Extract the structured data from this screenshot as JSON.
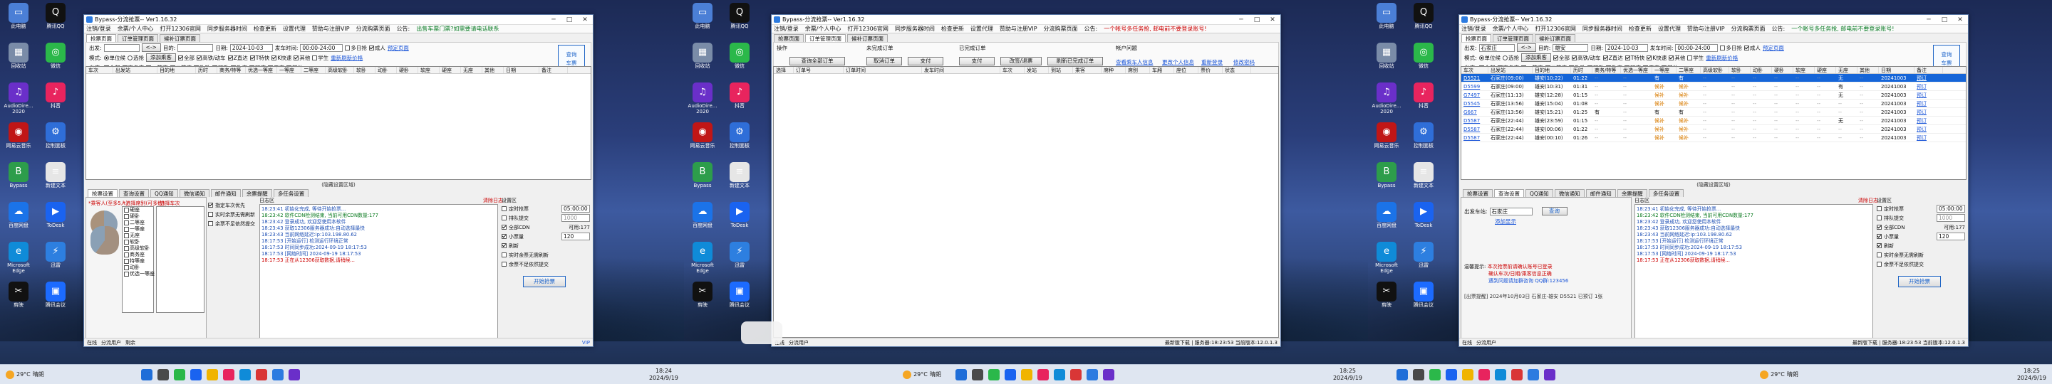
{
  "desktop_icons": [
    {
      "label": "此电脑",
      "color": "#4b7fd6",
      "glyph": "▭"
    },
    {
      "label": "腾讯QQ",
      "color": "#111111",
      "glyph": "Q"
    },
    {
      "label": "回收站",
      "color": "#7a8ca8",
      "glyph": "▦"
    },
    {
      "label": "微信",
      "color": "#2bb84a",
      "glyph": "◎"
    },
    {
      "label": "AudioDire... 2020",
      "color": "#6a2fc9",
      "glyph": "♫"
    },
    {
      "label": "抖音",
      "color": "#e8245e",
      "glyph": "♪"
    },
    {
      "label": "网易云音乐",
      "color": "#c01616",
      "glyph": "◉"
    },
    {
      "label": "控制面板",
      "color": "#2f6ed8",
      "glyph": "⚙"
    },
    {
      "label": "Bypass",
      "color": "#2d9d4b",
      "glyph": "B"
    },
    {
      "label": "新建文本",
      "color": "#e6e6e6",
      "glyph": "≡"
    },
    {
      "label": "百度网盘",
      "color": "#1b73e8",
      "glyph": "☁"
    },
    {
      "label": "ToDesk",
      "color": "#1a63f0",
      "glyph": "▶"
    },
    {
      "label": "Microsoft Edge",
      "color": "#0f8bd8",
      "glyph": "e"
    },
    {
      "label": "迅雷",
      "color": "#2d7fe0",
      "glyph": "⚡"
    },
    {
      "label": "剪映",
      "color": "#111111",
      "glyph": "✂"
    },
    {
      "label": "腾讯会议",
      "color": "#1c6bff",
      "glyph": "▣"
    }
  ],
  "title": "Bypass-分流抢票-- Ver1.16.32",
  "window_buttons": {
    "min": "─",
    "max": "□",
    "close": "✕"
  },
  "menu": [
    "注销/登录",
    "余票/个人中心",
    "打开12306官网",
    "同步服务器时间",
    "检查更新",
    "设置代理",
    "赞助与注册VIP",
    "分流购票页面",
    "公告:"
  ],
  "notice": {
    "n1": "出售车票门票?如需要请电话联系",
    "n2": "一个帐号多任务抢, 邮电前不要登录账号!"
  },
  "tabs": [
    "抢票页面",
    "订单管理页面",
    "候补订票页面"
  ],
  "query": {
    "from_label": "出发:",
    "from_value": "石家庄",
    "swap": "<->",
    "to_label": "目的:",
    "to_value": "雄安",
    "date_label": "日期:",
    "date_value": "2024-10-03",
    "time_label": "发车时间:",
    "time_value": "00:00-24:00",
    "multi_day": "多日抢",
    "adult": "成人",
    "student": "学生",
    "interval_label": "重新定时",
    "rob_button": "查询\n车票",
    "link1": "预定页面",
    "link2": "重新刷新价格",
    "train_type_label": "模式:",
    "types": [
      "单位候",
      "选抢",
      "全部",
      "G/D",
      "高铁/动车",
      "Z直达",
      "T特快",
      "K快速",
      "其他"
    ],
    "seats_label": "坐席:",
    "seats": [
      "全部",
      "商务座",
      "特等座",
      "一等座",
      "二等座",
      "高级软卧",
      "软卧",
      "动卧",
      "硬卧",
      "软座",
      "硬座",
      "无座",
      "其他"
    ],
    "seat_buttons": [
      "选座",
      "选择车次(多个)",
      "添加乘客",
      "选择人员",
      "候补"
    ]
  },
  "train_headers": [
    "车次",
    "出发站",
    "目的地",
    "历时",
    "商务/特等",
    "优选一等座",
    "一等座",
    "二等座",
    "高级软卧",
    "软卧",
    "动卧",
    "硬卧",
    "软座",
    "硬座",
    "无座",
    "其他",
    "日期",
    "备注"
  ],
  "trains": [
    {
      "no": "D5521",
      "from": "石家庄(09:00)",
      "to": "雄安(10:22)",
      "dur": "01:22",
      "c": [
        "--",
        "--",
        "有",
        "有",
        "--",
        "--",
        "--",
        "--",
        "--",
        "--",
        "无",
        "--"
      ],
      "date": "20241003",
      "memo": "预订",
      "sel": true
    },
    {
      "no": "D5599",
      "from": "石家庄(09:00)",
      "to": "雄安(10:31)",
      "dur": "01:31",
      "c": [
        "--",
        "--",
        "候补",
        "候补",
        "--",
        "--",
        "--",
        "--",
        "--",
        "--",
        "有",
        "--"
      ],
      "date": "20241003",
      "memo": "预订",
      "sel": false
    },
    {
      "no": "G7497",
      "from": "石家庄(11:13)",
      "to": "雄安(12:28)",
      "dur": "01:15",
      "c": [
        "--",
        "--",
        "候补",
        "候补",
        "--",
        "--",
        "--",
        "--",
        "--",
        "--",
        "无",
        "--"
      ],
      "date": "20241003",
      "memo": "预订",
      "sel": false
    },
    {
      "no": "D5545",
      "from": "石家庄(13:56)",
      "to": "雄安(15:04)",
      "dur": "01:08",
      "c": [
        "--",
        "--",
        "候补",
        "候补",
        "--",
        "--",
        "--",
        "--",
        "--",
        "--",
        "--",
        "--"
      ],
      "date": "20241003",
      "memo": "预订",
      "sel": false
    },
    {
      "no": "G667",
      "from": "石家庄(13:56)",
      "to": "雄安(15:21)",
      "dur": "01:25",
      "c": [
        "有",
        "--",
        "有",
        "有",
        "--",
        "--",
        "--",
        "--",
        "--",
        "--",
        "--",
        "--"
      ],
      "date": "20241003",
      "memo": "预订",
      "sel": false
    },
    {
      "no": "D5587",
      "from": "石家庄(22:44)",
      "to": "雄安(23:59)",
      "dur": "01:15",
      "c": [
        "--",
        "--",
        "候补",
        "候补",
        "--",
        "--",
        "--",
        "--",
        "--",
        "--",
        "无",
        "--"
      ],
      "date": "20241003",
      "memo": "预订",
      "sel": false
    },
    {
      "no": "D5587",
      "from": "石家庄(22:44)",
      "to": "雄安(00:06)",
      "dur": "01:22",
      "c": [
        "--",
        "--",
        "候补",
        "候补",
        "--",
        "--",
        "--",
        "--",
        "--",
        "--",
        "--",
        "--"
      ],
      "date": "20241003",
      "memo": "预订",
      "sel": false
    },
    {
      "no": "D5587",
      "from": "石家庄(22:44)",
      "to": "雄安(00:10)",
      "dur": "01:26",
      "c": [
        "--",
        "--",
        "候补",
        "候补",
        "--",
        "--",
        "--",
        "--",
        "--",
        "--",
        "--",
        "--"
      ],
      "date": "20241003",
      "memo": "预订",
      "sel": false
    }
  ],
  "order": {
    "op_label": "操作",
    "unpaid_label": "未完成订单",
    "paid_label": "已完成订单",
    "account_label": "帐户问题",
    "btn_query": "查询全部订单",
    "btn_cancel": "取消订单",
    "btn_pay": "支付",
    "btn_refund": "改签/退票",
    "btn_refresh": "刷新已完成订单",
    "links": [
      "查看乘车人信息",
      "更改个人信息",
      "重新登录",
      "修改密码"
    ],
    "headers": [
      "选择",
      "订单号",
      "订单时间",
      "发车时间",
      "车次",
      "发站",
      "到站",
      "乘客",
      "席种",
      "席别",
      "车厢",
      "座位",
      "票价",
      "状态"
    ]
  },
  "divider_label": "(隐藏设置区域)",
  "bottom_tabs": [
    "抢票设置",
    "查询设置",
    "QQ通知",
    "微信通知",
    "邮件通知",
    "余票提醒",
    "多任务设置"
  ],
  "passenger_label": "*乘客人(至多5人)",
  "seat_sel_label": "*选择席别(可多选)",
  "train_sel_label": "*选择车次",
  "seat_list": [
    "硬座",
    "硬卧",
    "二等座",
    "一等座",
    "无座",
    "软卧",
    "高级软卧",
    "商务座",
    "特等座",
    "动卧",
    "优选一等座"
  ],
  "log_title": "日志区",
  "log_lines": [
    {
      "t": "18:23:41 初始化完成, 等待开始抢票...",
      "c": ""
    },
    {
      "t": "18:23:42 软件CDN检测结束, 当前可用CDN数量:177",
      "c": "g"
    },
    {
      "t": "18:23:42 登录成功, 欢迎您使用本软件",
      "c": ""
    },
    {
      "t": "18:23:43 获取12306服务器成功:自动选择最快",
      "c": ""
    },
    {
      "t": "18:23:43 当前网络延迟:ip:103.198.80.62",
      "c": ""
    },
    {
      "t": "18:17:53 [开始运行] 检测运行环境正常",
      "c": ""
    },
    {
      "t": "18:17:53 时间同步成功:2024-09-19 18:17:53",
      "c": ""
    },
    {
      "t": "18:17:53 [网络时间] 2024-09-19 18:17:53",
      "c": ""
    },
    {
      "t": "18:17:53 正在从12306获取数据,请稍候...",
      "c": "r"
    }
  ],
  "clear_label": "清除日志",
  "settings_title": "设置区",
  "settings": {
    "timer_label": "定时抢票",
    "timer_value": "05:00:00",
    "auto_submit": "排队提交",
    "auto_submit_val": "1000",
    "intercept": "指定车次优先",
    "cdn": "全部CDN",
    "cdn_count": "可用:177",
    "refresh_label": "刷新",
    "refresh_val": "120",
    "small_label": "小票量",
    "realtime": "实时余票无需刷新",
    "no_repeat": "余票不足依然提交",
    "start_button": "开始抢票"
  },
  "query_settings": {
    "from_station": "出发车站:",
    "from_value": "石家庄",
    "query_btn": "查询",
    "link": "添加显示",
    "msg_label": "温馨提示:",
    "notices": [
      "本次抢票前请确认账号已登录",
      "确认车次/日期/乘客信息正确",
      "遇到问题请加群咨询 QQ群:123456"
    ],
    "rule": "[出票提醒] 2024年10月03日 石家庄-雄安 D5521 已预订 1张"
  },
  "statusbar": {
    "left": "在线",
    "proxy": "代理服务器",
    "user": "分流用户",
    "remain": "剩余",
    "ver": "VIP"
  },
  "status_right": "最新版下载 | 服务器:18:23:53 当前版本:12.0.1.3",
  "taskbar": {
    "weather_temp": "29°C",
    "weather_text": "晴朗",
    "time1": "18:24",
    "date1": "2024/9/19",
    "time2": "18:25",
    "date2": "2024/9/19",
    "time3": "18:25",
    "date3": "2024/9/19"
  }
}
